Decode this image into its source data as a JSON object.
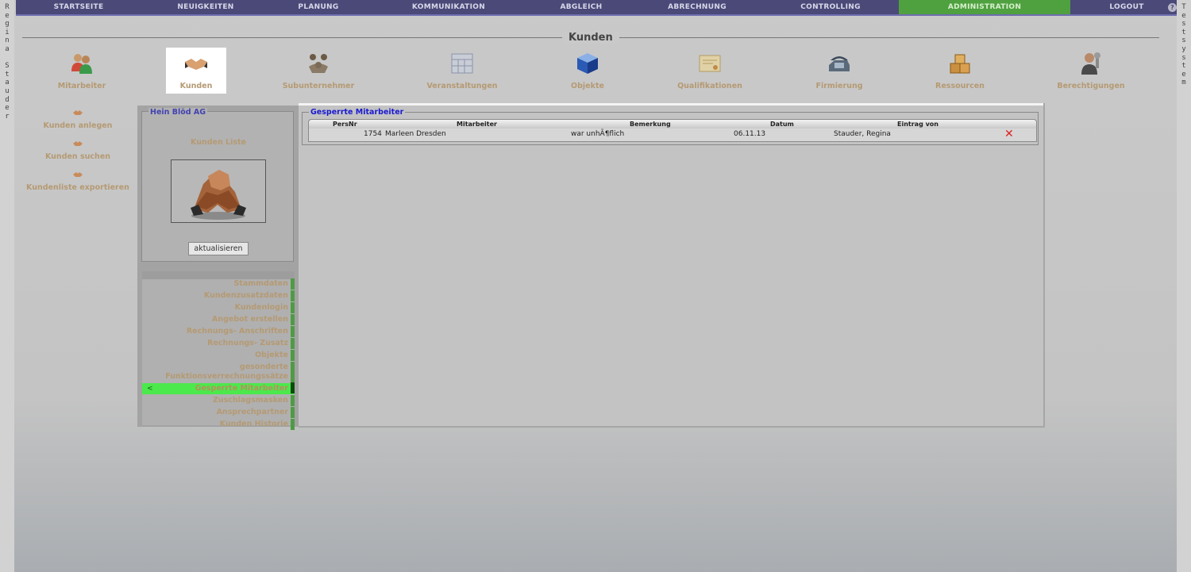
{
  "side_left": {
    "letters": [
      "R",
      "e",
      "g",
      "i",
      "n",
      "a",
      "",
      "S",
      "t",
      "a",
      "u",
      "d",
      "e",
      "r"
    ]
  },
  "side_right": {
    "letters": [
      "T",
      "e",
      "s",
      "t",
      "s",
      "y",
      "s",
      "t",
      "e",
      "m"
    ]
  },
  "nav": [
    {
      "label": "STARTSEITE"
    },
    {
      "label": "NEUIGKEITEN"
    },
    {
      "label": "PLANUNG"
    },
    {
      "label": "KOMMUNIKATION"
    },
    {
      "label": "ABGLEICH"
    },
    {
      "label": "ABRECHNUNG"
    },
    {
      "label": "CONTROLLING"
    },
    {
      "label": "ADMINISTRATION",
      "active": true
    },
    {
      "label": "LOGOUT"
    }
  ],
  "help_glyph": "?",
  "page_title": "Kunden",
  "modules": [
    {
      "label": "Mitarbeiter",
      "icon": "people-icon"
    },
    {
      "label": "Kunden",
      "icon": "handshake-icon",
      "active": true
    },
    {
      "label": "Subunternehmer",
      "icon": "group-icon"
    },
    {
      "label": "Veranstaltungen",
      "icon": "calendar-icon"
    },
    {
      "label": "Objekte",
      "icon": "cube-icon"
    },
    {
      "label": "Qualifikationen",
      "icon": "certificate-icon"
    },
    {
      "label": "Firmierung",
      "icon": "phone-icon"
    },
    {
      "label": "Ressourcen",
      "icon": "boxes-icon"
    },
    {
      "label": "Berechtigungen",
      "icon": "user-key-icon"
    }
  ],
  "actions": [
    {
      "label": "Kunden anlegen"
    },
    {
      "label": "Kunden suchen"
    },
    {
      "label": "Kundenliste exportieren"
    }
  ],
  "customer": {
    "name": "Hein Blöd AG",
    "list_label": "Kunden Liste",
    "refresh_label": "aktualisieren"
  },
  "menu": [
    {
      "label": "Stammdaten"
    },
    {
      "label": "Kundenzusatzdaten"
    },
    {
      "label": "Kundenlogin"
    },
    {
      "label": "Angebot erstellen"
    },
    {
      "label": "Rechnungs- Anschriften"
    },
    {
      "label": "Rechnungs- Zusatz"
    },
    {
      "label": "Objekte"
    },
    {
      "label": "gesonderte"
    },
    {
      "label": "Funktionsverrechnungssätze"
    },
    {
      "label": "Gesperrte Mitarbeiter",
      "active": true,
      "arrow": "<"
    },
    {
      "label": "Zuschlagsmasken"
    },
    {
      "label": "Ansprechpartner"
    },
    {
      "label": "Kunden Historie"
    }
  ],
  "blocked": {
    "legend": "Gesperrte Mitarbeiter",
    "headers": {
      "persnr": "PersNr",
      "mitarbeiter": "Mitarbeiter",
      "bemerkung": "Bemerkung",
      "datum": "Datum",
      "eintrag": "Eintrag von"
    },
    "rows": [
      {
        "persnr": "1754",
        "mitarbeiter": "Marleen Dresden",
        "bemerkung": "war unhÃ¶flich",
        "datum": "06.11.13",
        "eintrag": "Stauder, Regina",
        "action_glyph": "✕"
      }
    ]
  }
}
